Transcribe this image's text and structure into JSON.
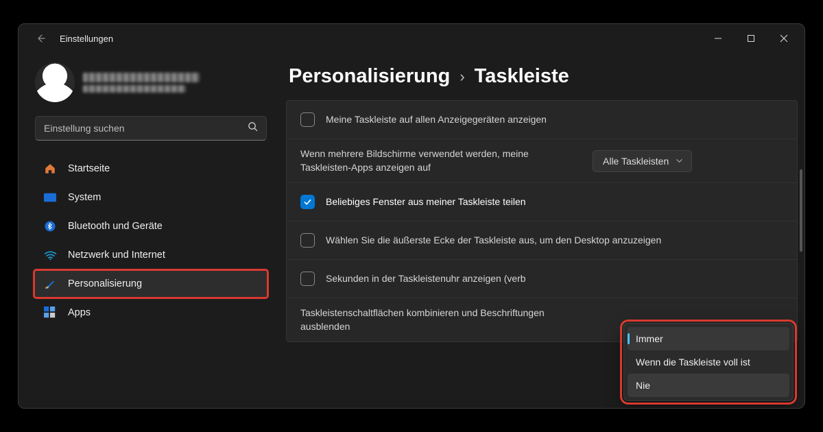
{
  "window": {
    "title": "Einstellungen"
  },
  "profile": {
    "name_redacted": true
  },
  "search": {
    "placeholder": "Einstellung suchen"
  },
  "sidebar": {
    "items": [
      {
        "label": "Startseite",
        "icon": "home"
      },
      {
        "label": "System",
        "icon": "system"
      },
      {
        "label": "Bluetooth und Geräte",
        "icon": "bluetooth"
      },
      {
        "label": "Netzwerk und Internet",
        "icon": "wifi"
      },
      {
        "label": "Personalisierung",
        "icon": "brush",
        "active": true
      },
      {
        "label": "Apps",
        "icon": "apps"
      }
    ]
  },
  "breadcrumb": {
    "parent": "Personalisierung",
    "current": "Taskleiste"
  },
  "rows": {
    "r1": {
      "label": "Meine Taskleiste auf allen Anzeigegeräten anzeigen",
      "checked": false
    },
    "r2": {
      "label": "Wenn mehrere Bildschirme verwendet werden, meine Taskleisten-Apps anzeigen auf",
      "select": "Alle Taskleisten"
    },
    "r3": {
      "label": "Beliebiges Fenster aus meiner Taskleiste teilen",
      "checked": true
    },
    "r4": {
      "label": "Wählen Sie die äußerste Ecke der Taskleiste aus, um den Desktop anzuzeigen",
      "checked": false
    },
    "r5": {
      "label": "Sekunden in der Taskleistenuhr anzeigen (verb",
      "checked": false
    },
    "r6": {
      "label": "Taskleistenschaltflächen kombinieren und Beschriftungen ausblenden"
    }
  },
  "popup": {
    "items": [
      {
        "label": "Immer",
        "selected": true
      },
      {
        "label": "Wenn die Taskleiste voll ist"
      },
      {
        "label": "Nie",
        "hover": true
      }
    ]
  }
}
